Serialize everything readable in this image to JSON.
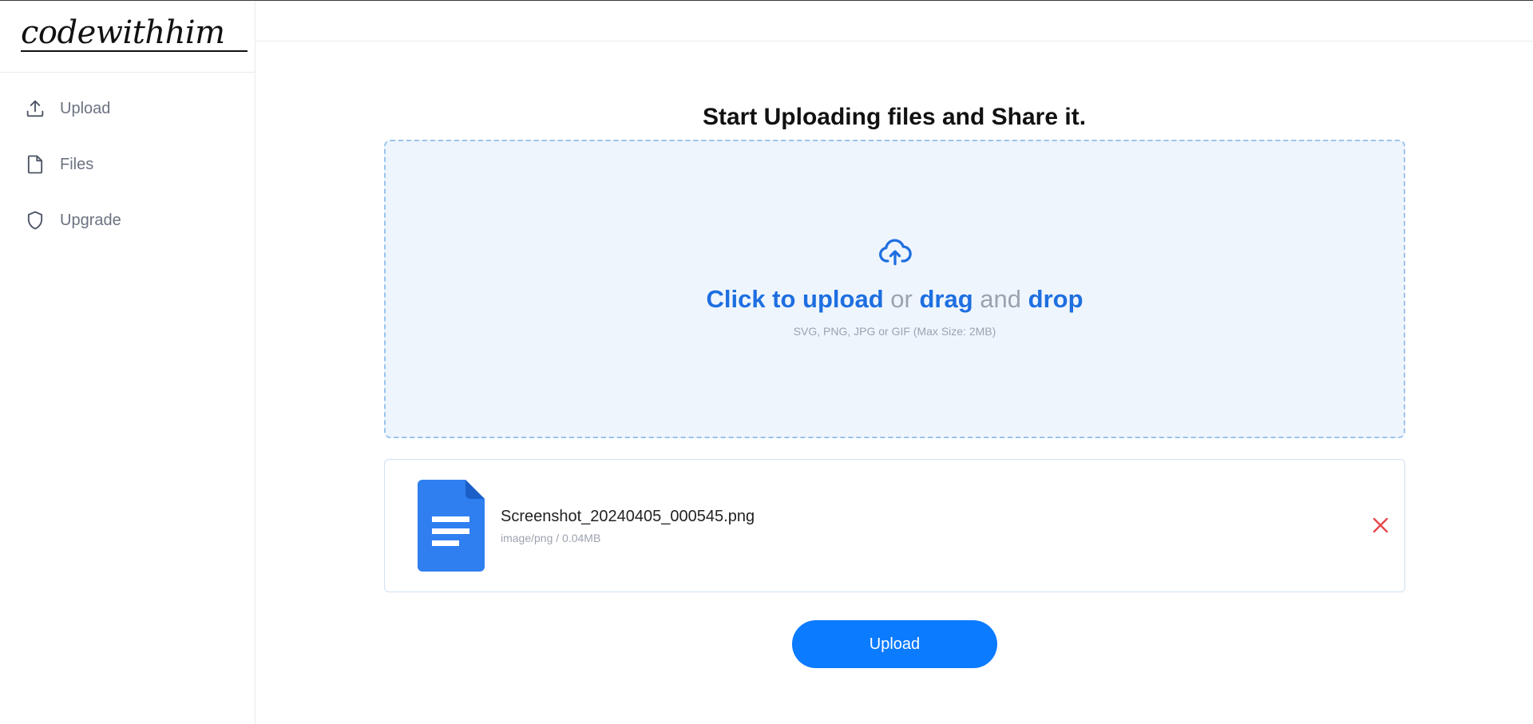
{
  "brand": {
    "logo_text": "codewithhim"
  },
  "sidebar": {
    "items": [
      {
        "label": "Upload",
        "icon": "upload-icon"
      },
      {
        "label": "Files",
        "icon": "file-icon"
      },
      {
        "label": "Upgrade",
        "icon": "shield-icon"
      }
    ]
  },
  "main": {
    "title": "Start Uploading files and Share it.",
    "dropzone": {
      "icon": "cloud-upload-icon",
      "click_text": "Click to upload",
      "or_text": "or",
      "drag_text": "drag",
      "and_text": "and",
      "drop_text": "drop",
      "hint": "SVG, PNG, JPG or GIF (Max Size: 2MB)"
    },
    "file": {
      "name": "Screenshot_20240405_000545.png",
      "meta": "image/png / 0.04MB",
      "icon": "document-icon",
      "remove_icon": "close-icon"
    },
    "upload_button_label": "Upload"
  },
  "colors": {
    "accent": "#0b7bff",
    "dropzone_bg": "#eef5fd",
    "dropzone_border": "#9cc4ec",
    "remove": "#e5484d",
    "doc_icon": "#2f7ff0"
  }
}
